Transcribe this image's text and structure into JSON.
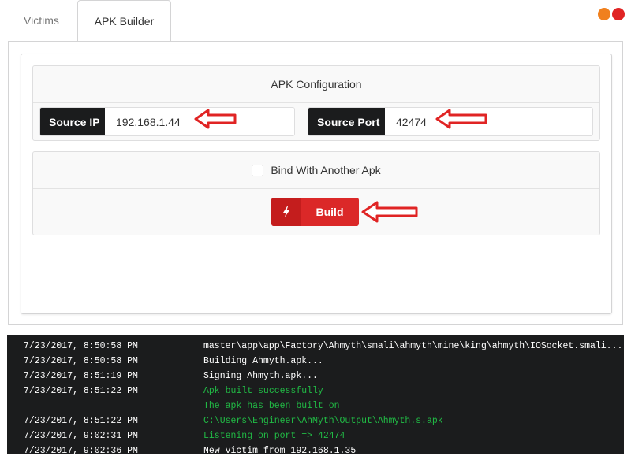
{
  "tabs": [
    {
      "label": "Victims"
    },
    {
      "label": "APK Builder"
    }
  ],
  "config": {
    "header": "APK Configuration",
    "ip_label": "Source IP",
    "ip_value": "192.168.1.44",
    "port_label": "Source Port",
    "port_value": "42474"
  },
  "bind": {
    "label": "Bind With Another Apk"
  },
  "build": {
    "label": "Build"
  },
  "colors": {
    "accent": "#db2828",
    "dark": "#1b1c1d",
    "log_green": "#21ba45",
    "arrow": "#e02424"
  },
  "logs": [
    {
      "time": "7/23/2017, 8:50:58 PM",
      "msg": "master\\app\\app\\Factory\\Ahmyth\\smali\\ahmyth\\mine\\king\\ahmyth\\IOSocket.smali...",
      "color": "white"
    },
    {
      "time": "7/23/2017, 8:50:58 PM",
      "msg": "Building Ahmyth.apk...",
      "color": "white"
    },
    {
      "time": "7/23/2017, 8:51:19 PM",
      "msg": "Signing Ahmyth.apk...",
      "color": "white"
    },
    {
      "time": "7/23/2017, 8:51:22 PM",
      "msg": "Apk built successfully",
      "color": "green"
    },
    {
      "time": "",
      "msg": "The apk has been built on",
      "color": "green"
    },
    {
      "time": "7/23/2017, 8:51:22 PM",
      "msg": "C:\\Users\\Engineer\\AhMyth\\Output\\Ahmyth.s.apk",
      "color": "green"
    },
    {
      "time": "7/23/2017, 9:02:31 PM",
      "msg": "Listening on port => 42474",
      "color": "green"
    },
    {
      "time": "7/23/2017, 9:02:36 PM",
      "msg": "New victim from 192.168.1.35",
      "color": "white"
    }
  ]
}
